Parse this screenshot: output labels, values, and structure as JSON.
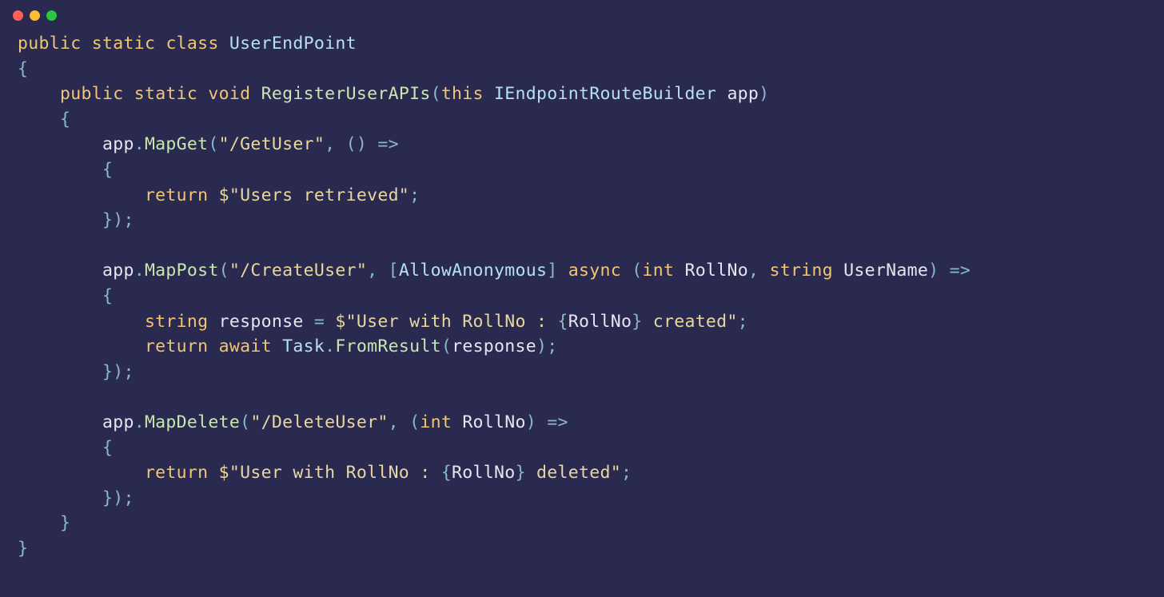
{
  "colors": {
    "background": "#2a2a50",
    "keyword": "#f0c674",
    "type": "#b4e0f0",
    "method": "#c8e6b0",
    "string": "#e8d8a0",
    "punct": "#89b8c8",
    "plain": "#e6e6f0"
  },
  "code": {
    "line1_public": "public",
    "line1_static": "static",
    "line1_class": "class",
    "line1_type": "UserEndPoint",
    "line2_brace": "{",
    "line3_public": "public",
    "line3_static": "static",
    "line3_void": "void",
    "line3_method": "RegisterUserAPIs",
    "line3_lparen": "(",
    "line3_this": "this",
    "line3_paramtype": "IEndpointRouteBuilder",
    "line3_param": "app",
    "line3_rparen": ")",
    "line4_brace": "{",
    "line5_app": "app",
    "line5_dot": ".",
    "line5_method": "MapGet",
    "line5_lparen": "(",
    "line5_str": "\"/GetUser\"",
    "line5_comma": ",",
    "line5_lambda": "()",
    "line5_arrow": "=>",
    "line6_brace": "{",
    "line7_return": "return",
    "line7_dollar": "$",
    "line7_str": "\"Users retrieved\"",
    "line7_semi": ";",
    "line8_brace": "});",
    "line10_app": "app",
    "line10_dot": ".",
    "line10_method": "MapPost",
    "line10_lparen": "(",
    "line10_str": "\"/CreateUser\"",
    "line10_comma": ",",
    "line10_lbracket": "[",
    "line10_attr": "AllowAnonymous",
    "line10_rbracket": "]",
    "line10_async": "async",
    "line10_lparen2": "(",
    "line10_int": "int",
    "line10_rollno": "RollNo",
    "line10_comma2": ",",
    "line10_string": "string",
    "line10_username": "UserName",
    "line10_rparen": ")",
    "line10_arrow": "=>",
    "line11_brace": "{",
    "line12_string": "string",
    "line12_response": "response",
    "line12_eq": "=",
    "line12_dollar": "$",
    "line12_str1": "\"User with RollNo : ",
    "line12_lbrace": "{",
    "line12_rollno": "RollNo",
    "line12_rbrace": "}",
    "line12_str2": " created\"",
    "line12_semi": ";",
    "line13_return": "return",
    "line13_await": "await",
    "line13_task": "Task",
    "line13_dot": ".",
    "line13_method": "FromResult",
    "line13_lparen": "(",
    "line13_response": "response",
    "line13_rparen": ");",
    "line14_brace": "});",
    "line16_app": "app",
    "line16_dot": ".",
    "line16_method": "MapDelete",
    "line16_lparen": "(",
    "line16_str": "\"/DeleteUser\"",
    "line16_comma": ",",
    "line16_lparen2": "(",
    "line16_int": "int",
    "line16_rollno": "RollNo",
    "line16_rparen": ")",
    "line16_arrow": "=>",
    "line17_brace": "{",
    "line18_return": "return",
    "line18_dollar": "$",
    "line18_str1": "\"User with RollNo : ",
    "line18_lbrace": "{",
    "line18_rollno": "RollNo",
    "line18_rbrace": "}",
    "line18_str2": " deleted\"",
    "line18_semi": ";",
    "line19_brace": "});",
    "line20_brace": "}",
    "line21_brace": "}"
  }
}
